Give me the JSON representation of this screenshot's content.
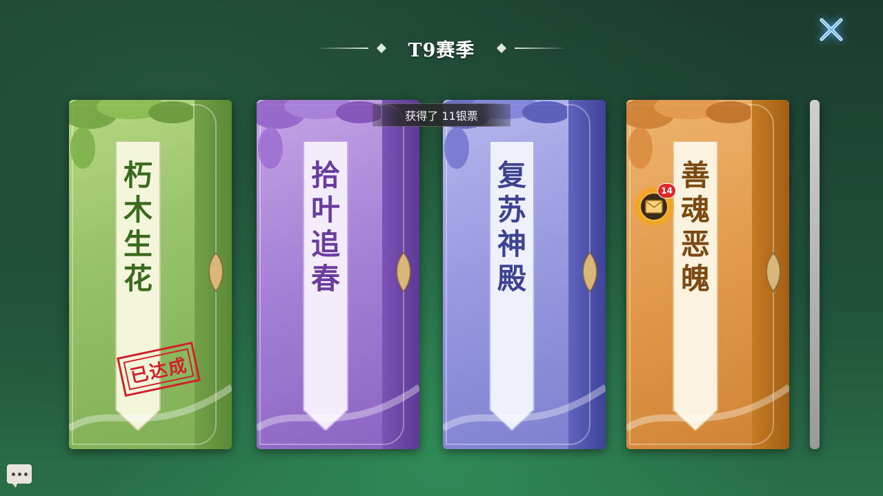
{
  "header": {
    "title": "T9赛季"
  },
  "toast": {
    "text": "获得了 11银票"
  },
  "cards": [
    {
      "name": [
        "朽",
        "木",
        "生",
        "花"
      ],
      "theme": "green",
      "accent": "#3a6a1d",
      "stamp": "已达成"
    },
    {
      "name": [
        "拾",
        "叶",
        "追",
        "春"
      ],
      "theme": "purple",
      "accent": "#6a3ca0"
    },
    {
      "name": [
        "复",
        "苏",
        "神",
        "殿"
      ],
      "theme": "blue",
      "accent": "#3d4390"
    },
    {
      "name": [
        "善",
        "魂",
        "恶",
        "魄"
      ],
      "theme": "orange",
      "accent": "#7a4a12"
    }
  ],
  "mail": {
    "icon": "envelope-icon",
    "badge": "14"
  },
  "close": {
    "icon": "close-icon"
  },
  "chat": {
    "icon": "chat-bubble-icon"
  }
}
